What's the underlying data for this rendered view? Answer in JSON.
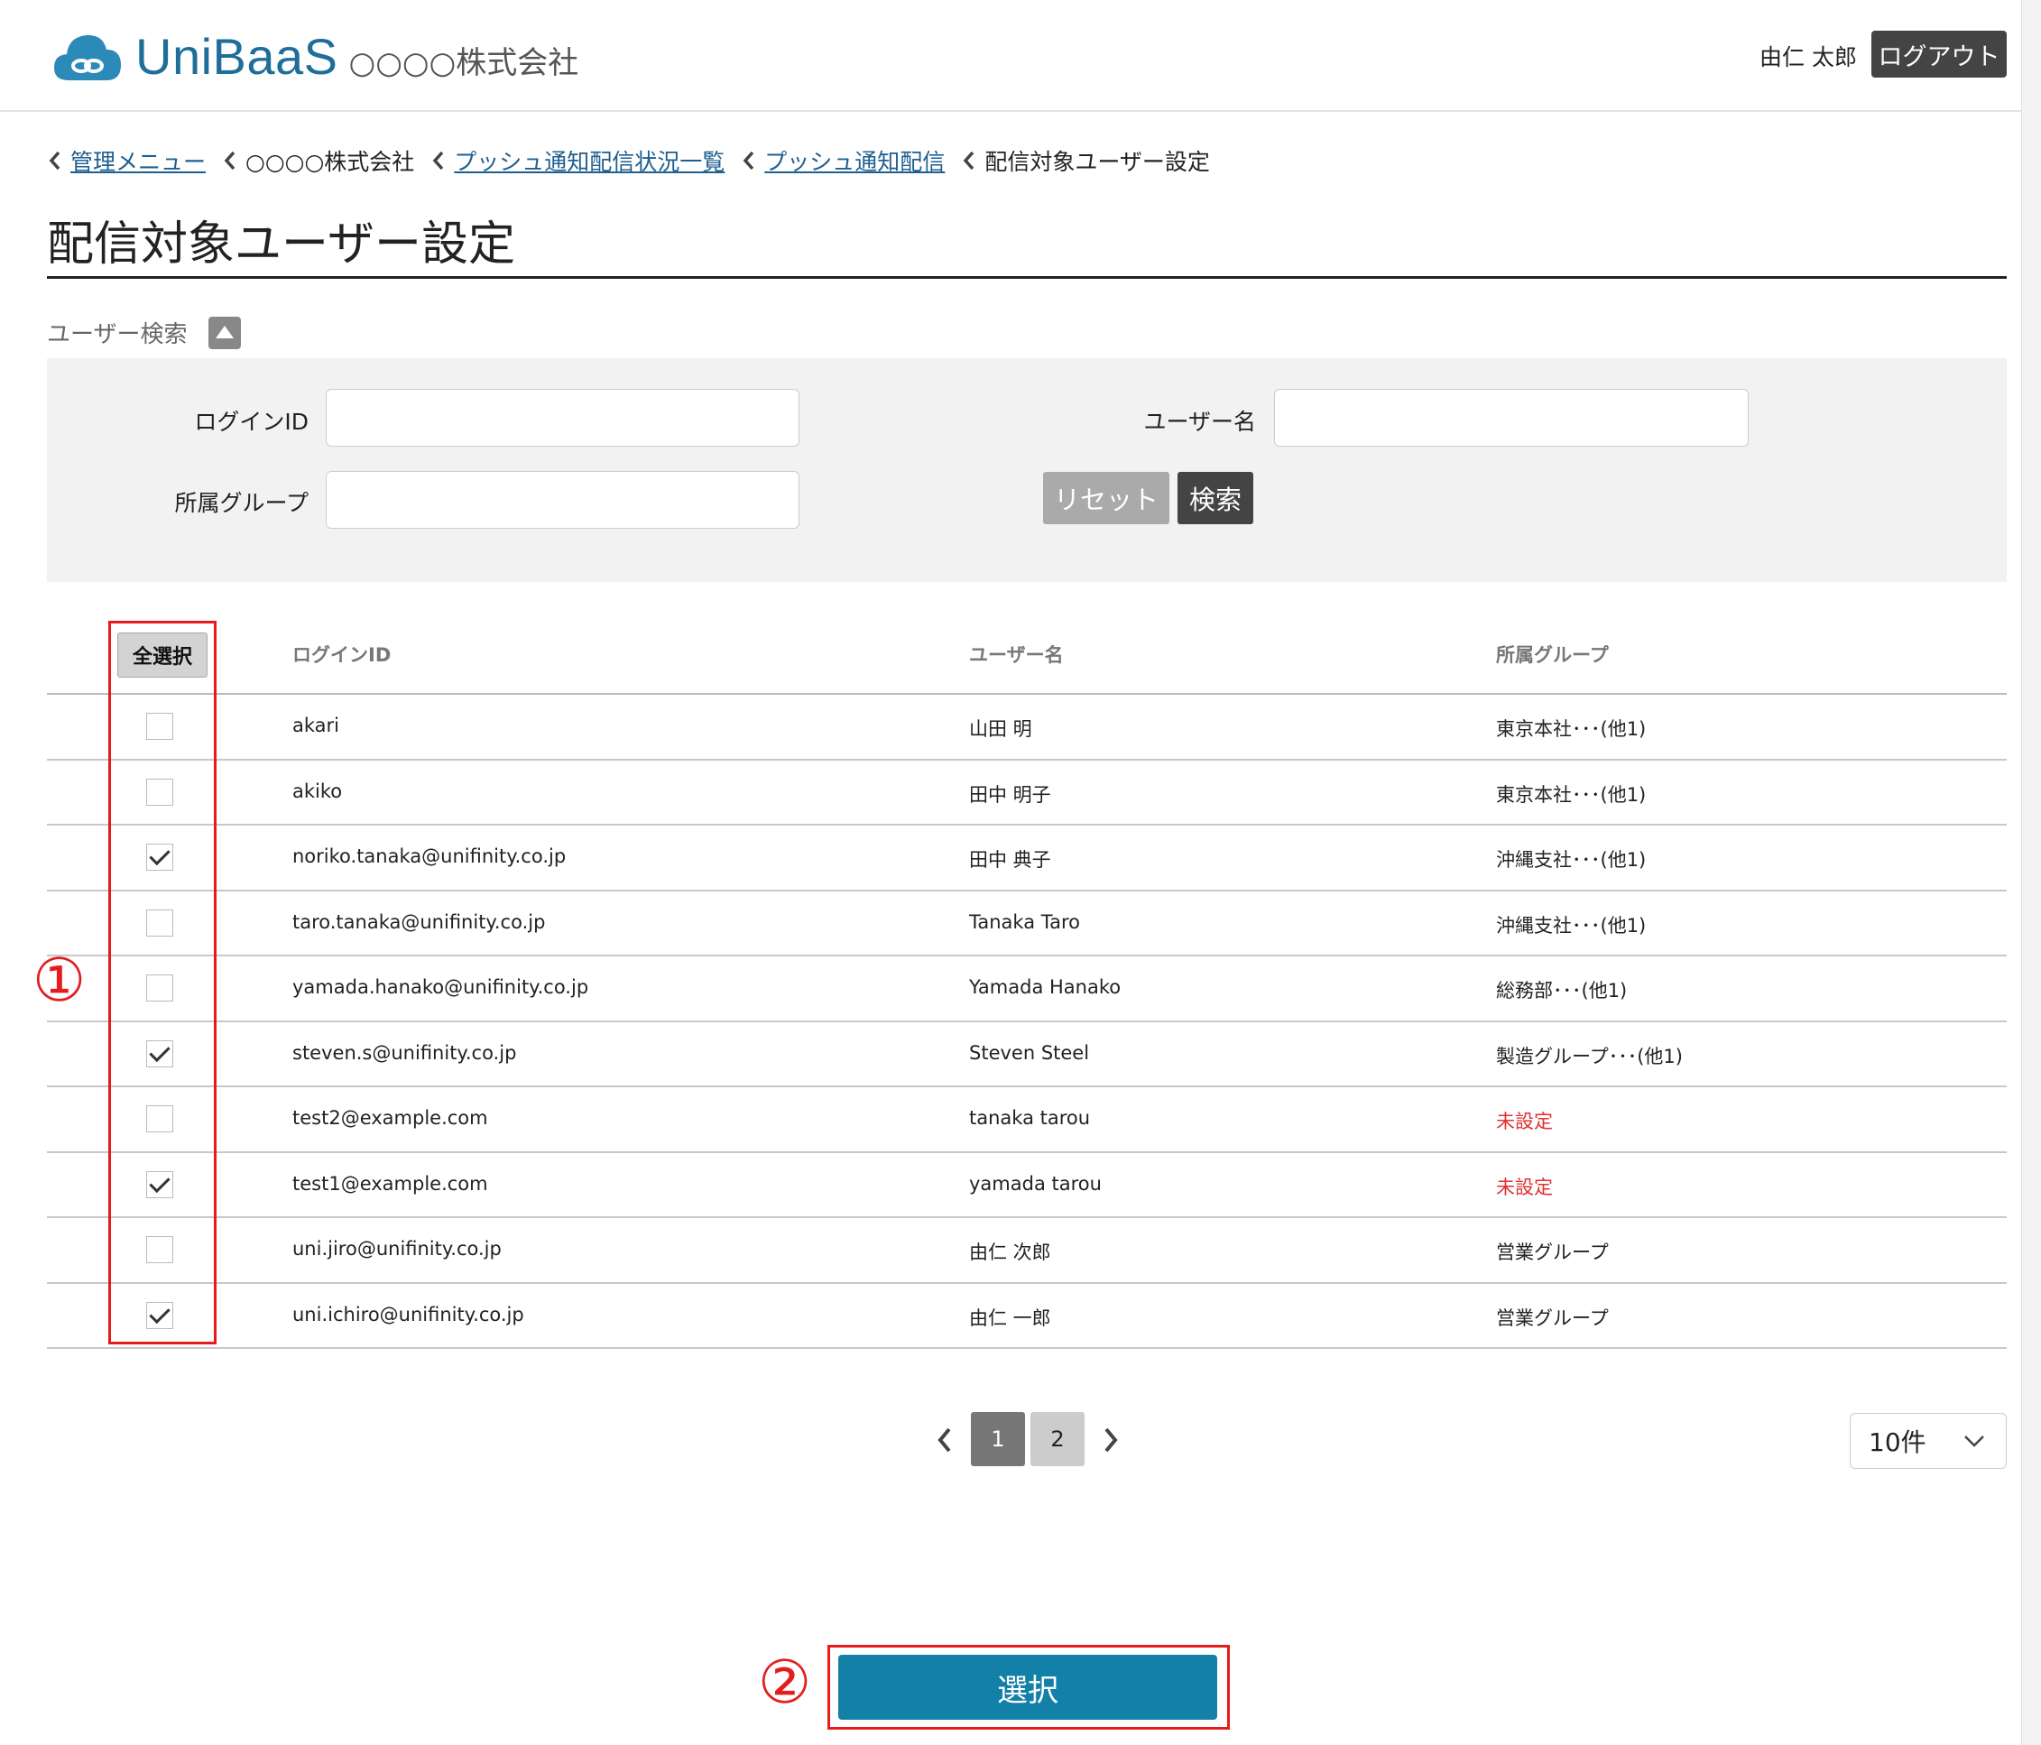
{
  "header": {
    "brand": "UniBaaS",
    "company": "○○○○株式会社",
    "user_name": "由仁 太郎",
    "logout_label": "ログアウト"
  },
  "breadcrumb": [
    {
      "label": "管理メニュー",
      "link": true
    },
    {
      "label": "○○○○株式会社",
      "link": false
    },
    {
      "label": "プッシュ通知配信状況一覧",
      "link": true
    },
    {
      "label": "プッシュ通知配信",
      "link": true
    },
    {
      "label": "配信対象ユーザー設定",
      "link": false
    }
  ],
  "page_title": "配信対象ユーザー設定",
  "search": {
    "section_label": "ユーザー検索",
    "login_id_label": "ログインID",
    "login_id_value": "",
    "user_name_label": "ユーザー名",
    "user_name_value": "",
    "group_label": "所属グループ",
    "group_value": "",
    "reset_label": "リセット",
    "search_label": "検索"
  },
  "table": {
    "select_all_label": "全選択",
    "columns": [
      "ログインID",
      "ユーザー名",
      "所属グループ"
    ],
    "rows": [
      {
        "checked": false,
        "login_id": "akari",
        "name": "山田 明",
        "group": "東京本社･･･(他1)",
        "unset": false
      },
      {
        "checked": false,
        "login_id": "akiko",
        "name": "田中 明子",
        "group": "東京本社･･･(他1)",
        "unset": false
      },
      {
        "checked": true,
        "login_id": "noriko.tanaka@unifinity.co.jp",
        "name": "田中 典子",
        "group": "沖縄支社･･･(他1)",
        "unset": false
      },
      {
        "checked": false,
        "login_id": "taro.tanaka@unifinity.co.jp",
        "name": "Tanaka Taro",
        "group": "沖縄支社･･･(他1)",
        "unset": false
      },
      {
        "checked": false,
        "login_id": "yamada.hanako@unifinity.co.jp",
        "name": "Yamada Hanako",
        "group": "総務部･･･(他1)",
        "unset": false
      },
      {
        "checked": true,
        "login_id": "steven.s@unifinity.co.jp",
        "name": "Steven Steel",
        "group": "製造グループ･･･(他1)",
        "unset": false
      },
      {
        "checked": false,
        "login_id": "test2@example.com",
        "name": "tanaka tarou",
        "group": "未設定",
        "unset": true
      },
      {
        "checked": true,
        "login_id": "test1@example.com",
        "name": "yamada tarou",
        "group": "未設定",
        "unset": true
      },
      {
        "checked": false,
        "login_id": "uni.jiro@unifinity.co.jp",
        "name": "由仁 次郎",
        "group": "営業グループ",
        "unset": false
      },
      {
        "checked": true,
        "login_id": "uni.ichiro@unifinity.co.jp",
        "name": "由仁 一郎",
        "group": "営業グループ",
        "unset": false
      }
    ]
  },
  "pagination": {
    "pages": [
      "1",
      "2"
    ],
    "current": "1",
    "per_page": "10件"
  },
  "select_button_label": "選択",
  "annotations": {
    "marker_1": "①",
    "marker_2": "②"
  },
  "colors": {
    "brand": "#1f6e9a",
    "primary_button": "#1380a8",
    "annotation_red": "#e51c1c",
    "unset_text": "#e03030"
  }
}
